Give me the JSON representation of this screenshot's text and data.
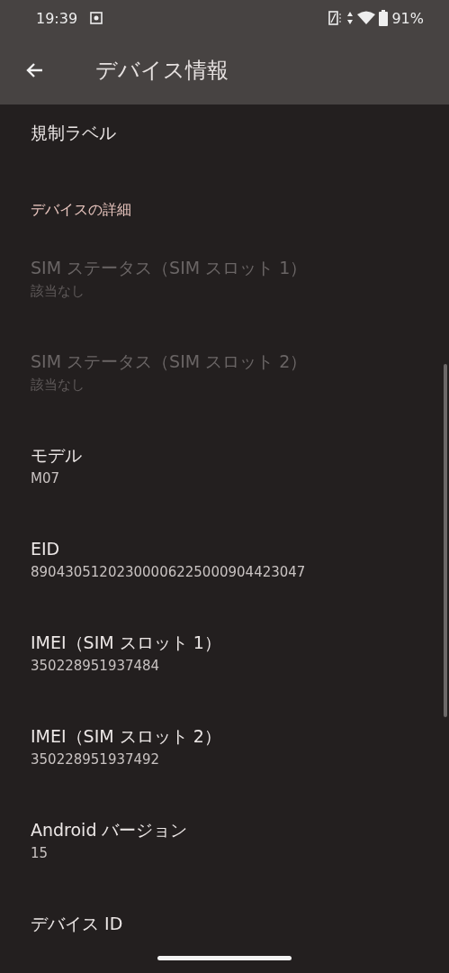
{
  "status_bar": {
    "time": "19:39",
    "battery": "91%"
  },
  "app_bar": {
    "title": "デバイス情報"
  },
  "items": [
    {
      "kind": "item",
      "title": "規制ラベル",
      "disabled": false
    },
    {
      "kind": "header",
      "title": "デバイスの詳細"
    },
    {
      "kind": "item",
      "title": "SIM ステータス（SIM スロット 1）",
      "summary": "該当なし",
      "disabled": true
    },
    {
      "kind": "item",
      "title": "SIM ステータス（SIM スロット 2）",
      "summary": "該当なし",
      "disabled": true
    },
    {
      "kind": "item",
      "title": "モデル",
      "summary": "M07",
      "disabled": false
    },
    {
      "kind": "item",
      "title": "EID",
      "summary": "89043051202300006225000904423047",
      "disabled": false
    },
    {
      "kind": "item",
      "title": "IMEI（SIM スロット 1）",
      "summary": "350228951937484",
      "disabled": false
    },
    {
      "kind": "item",
      "title": "IMEI（SIM スロット 2）",
      "summary": "350228951937492",
      "disabled": false
    },
    {
      "kind": "item",
      "title": "Android バージョン",
      "summary": "15",
      "disabled": false
    },
    {
      "kind": "item",
      "title": "デバイス ID",
      "disabled": false
    }
  ]
}
